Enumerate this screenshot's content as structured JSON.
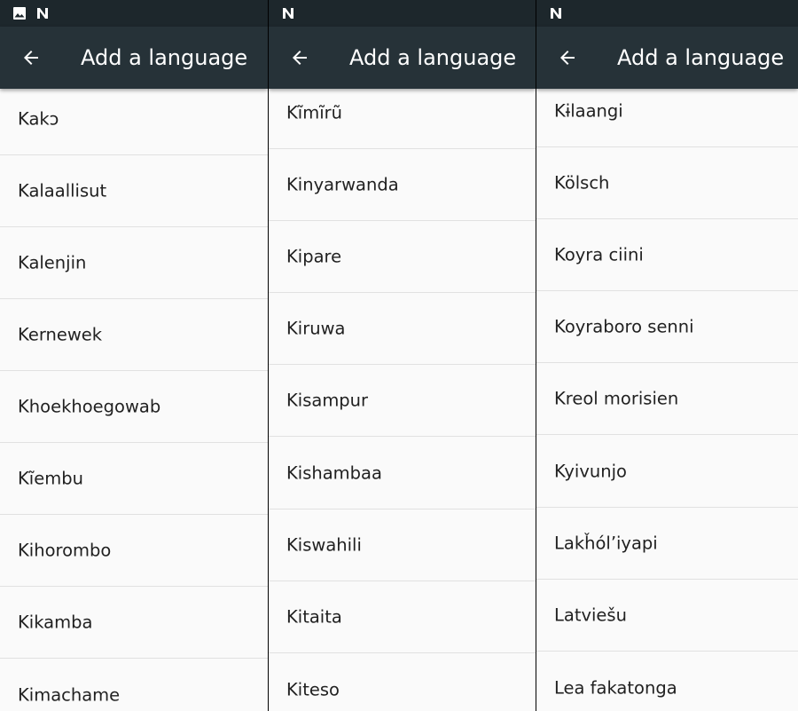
{
  "screens": [
    {
      "status_icons": [
        "image-icon",
        "n-logo-icon"
      ],
      "app_bar": {
        "title": "Add a language",
        "back_icon": "arrow-back-icon"
      },
      "items": [
        "Kakɔ",
        "Kalaallisut",
        "Kalenjin",
        "Kernewek",
        "Khoekhoegowab",
        "Kĩembu",
        "Kihorombo",
        "Kikamba",
        "Kimachame"
      ]
    },
    {
      "status_icons": [
        "n-logo-icon"
      ],
      "app_bar": {
        "title": "Add a language",
        "back_icon": "arrow-back-icon"
      },
      "items": [
        "Kĩmĩrũ",
        "Kinyarwanda",
        "Kipare",
        "Kiruwa",
        "Kisampur",
        "Kishambaa",
        "Kiswahili",
        "Kitaita",
        "Kiteso"
      ]
    },
    {
      "status_icons": [
        "n-logo-icon"
      ],
      "app_bar": {
        "title": "Add a language",
        "back_icon": "arrow-back-icon"
      },
      "items": [
        "Kɨlaangi",
        "Kölsch",
        "Koyra ciini",
        "Koyraboro senni",
        "Kreol morisien",
        "Kyivunjo",
        "Lakȟól’iyapi",
        "Latviešu",
        "Lea fakatonga"
      ]
    }
  ]
}
